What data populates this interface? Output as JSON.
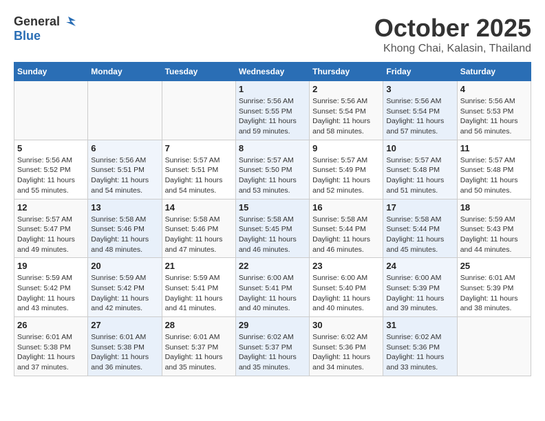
{
  "header": {
    "logo_line1": "General",
    "logo_line2": "Blue",
    "month": "October 2025",
    "location": "Khong Chai, Kalasin, Thailand"
  },
  "weekdays": [
    "Sunday",
    "Monday",
    "Tuesday",
    "Wednesday",
    "Thursday",
    "Friday",
    "Saturday"
  ],
  "weeks": [
    [
      {
        "day": "",
        "info": ""
      },
      {
        "day": "",
        "info": ""
      },
      {
        "day": "",
        "info": ""
      },
      {
        "day": "1",
        "info": "Sunrise: 5:56 AM\nSunset: 5:55 PM\nDaylight: 11 hours\nand 59 minutes."
      },
      {
        "day": "2",
        "info": "Sunrise: 5:56 AM\nSunset: 5:54 PM\nDaylight: 11 hours\nand 58 minutes."
      },
      {
        "day": "3",
        "info": "Sunrise: 5:56 AM\nSunset: 5:54 PM\nDaylight: 11 hours\nand 57 minutes."
      },
      {
        "day": "4",
        "info": "Sunrise: 5:56 AM\nSunset: 5:53 PM\nDaylight: 11 hours\nand 56 minutes."
      }
    ],
    [
      {
        "day": "5",
        "info": "Sunrise: 5:56 AM\nSunset: 5:52 PM\nDaylight: 11 hours\nand 55 minutes."
      },
      {
        "day": "6",
        "info": "Sunrise: 5:56 AM\nSunset: 5:51 PM\nDaylight: 11 hours\nand 54 minutes."
      },
      {
        "day": "7",
        "info": "Sunrise: 5:57 AM\nSunset: 5:51 PM\nDaylight: 11 hours\nand 54 minutes."
      },
      {
        "day": "8",
        "info": "Sunrise: 5:57 AM\nSunset: 5:50 PM\nDaylight: 11 hours\nand 53 minutes."
      },
      {
        "day": "9",
        "info": "Sunrise: 5:57 AM\nSunset: 5:49 PM\nDaylight: 11 hours\nand 52 minutes."
      },
      {
        "day": "10",
        "info": "Sunrise: 5:57 AM\nSunset: 5:48 PM\nDaylight: 11 hours\nand 51 minutes."
      },
      {
        "day": "11",
        "info": "Sunrise: 5:57 AM\nSunset: 5:48 PM\nDaylight: 11 hours\nand 50 minutes."
      }
    ],
    [
      {
        "day": "12",
        "info": "Sunrise: 5:57 AM\nSunset: 5:47 PM\nDaylight: 11 hours\nand 49 minutes."
      },
      {
        "day": "13",
        "info": "Sunrise: 5:58 AM\nSunset: 5:46 PM\nDaylight: 11 hours\nand 48 minutes."
      },
      {
        "day": "14",
        "info": "Sunrise: 5:58 AM\nSunset: 5:46 PM\nDaylight: 11 hours\nand 47 minutes."
      },
      {
        "day": "15",
        "info": "Sunrise: 5:58 AM\nSunset: 5:45 PM\nDaylight: 11 hours\nand 46 minutes."
      },
      {
        "day": "16",
        "info": "Sunrise: 5:58 AM\nSunset: 5:44 PM\nDaylight: 11 hours\nand 46 minutes."
      },
      {
        "day": "17",
        "info": "Sunrise: 5:58 AM\nSunset: 5:44 PM\nDaylight: 11 hours\nand 45 minutes."
      },
      {
        "day": "18",
        "info": "Sunrise: 5:59 AM\nSunset: 5:43 PM\nDaylight: 11 hours\nand 44 minutes."
      }
    ],
    [
      {
        "day": "19",
        "info": "Sunrise: 5:59 AM\nSunset: 5:42 PM\nDaylight: 11 hours\nand 43 minutes."
      },
      {
        "day": "20",
        "info": "Sunrise: 5:59 AM\nSunset: 5:42 PM\nDaylight: 11 hours\nand 42 minutes."
      },
      {
        "day": "21",
        "info": "Sunrise: 5:59 AM\nSunset: 5:41 PM\nDaylight: 11 hours\nand 41 minutes."
      },
      {
        "day": "22",
        "info": "Sunrise: 6:00 AM\nSunset: 5:41 PM\nDaylight: 11 hours\nand 40 minutes."
      },
      {
        "day": "23",
        "info": "Sunrise: 6:00 AM\nSunset: 5:40 PM\nDaylight: 11 hours\nand 40 minutes."
      },
      {
        "day": "24",
        "info": "Sunrise: 6:00 AM\nSunset: 5:39 PM\nDaylight: 11 hours\nand 39 minutes."
      },
      {
        "day": "25",
        "info": "Sunrise: 6:01 AM\nSunset: 5:39 PM\nDaylight: 11 hours\nand 38 minutes."
      }
    ],
    [
      {
        "day": "26",
        "info": "Sunrise: 6:01 AM\nSunset: 5:38 PM\nDaylight: 11 hours\nand 37 minutes."
      },
      {
        "day": "27",
        "info": "Sunrise: 6:01 AM\nSunset: 5:38 PM\nDaylight: 11 hours\nand 36 minutes."
      },
      {
        "day": "28",
        "info": "Sunrise: 6:01 AM\nSunset: 5:37 PM\nDaylight: 11 hours\nand 35 minutes."
      },
      {
        "day": "29",
        "info": "Sunrise: 6:02 AM\nSunset: 5:37 PM\nDaylight: 11 hours\nand 35 minutes."
      },
      {
        "day": "30",
        "info": "Sunrise: 6:02 AM\nSunset: 5:36 PM\nDaylight: 11 hours\nand 34 minutes."
      },
      {
        "day": "31",
        "info": "Sunrise: 6:02 AM\nSunset: 5:36 PM\nDaylight: 11 hours\nand 33 minutes."
      },
      {
        "day": "",
        "info": ""
      }
    ]
  ]
}
